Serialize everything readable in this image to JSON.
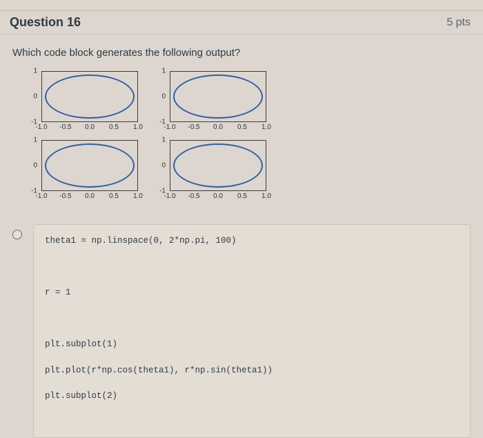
{
  "header": {
    "title": "Question 16",
    "points": "5 pts"
  },
  "prompt": "Which code block generates the following output?",
  "chart_data": [
    {
      "type": "line",
      "parametric": true,
      "x_expr": "cos(t)",
      "y_expr": "sin(t)",
      "xlim": [
        -1.0,
        1.0
      ],
      "ylim": [
        -1,
        1
      ],
      "xticks": [
        "-1.0",
        "-0.5",
        "0.0",
        "0.5",
        "1.0"
      ],
      "yticks": [
        "1",
        "0",
        "-1"
      ]
    },
    {
      "type": "line",
      "parametric": true,
      "x_expr": "cos(t)",
      "y_expr": "sin(t)",
      "xlim": [
        -1.0,
        1.0
      ],
      "ylim": [
        -1,
        1
      ],
      "xticks": [
        "-1.0",
        "-0.5",
        "0.0",
        "0.5",
        "1.0"
      ],
      "yticks": [
        "1",
        "0",
        "-1"
      ]
    },
    {
      "type": "line",
      "parametric": true,
      "x_expr": "cos(t)",
      "y_expr": "sin(t)",
      "xlim": [
        -1.0,
        1.0
      ],
      "ylim": [
        -1,
        1
      ],
      "xticks": [
        "-1.0",
        "-0.5",
        "0.0",
        "0.5",
        "1.0"
      ],
      "yticks": [
        "1",
        "0",
        "-1"
      ]
    },
    {
      "type": "line",
      "parametric": true,
      "x_expr": "cos(t)",
      "y_expr": "sin(t)",
      "xlim": [
        -1.0,
        1.0
      ],
      "ylim": [
        -1,
        1
      ],
      "xticks": [
        "-1.0",
        "-0.5",
        "0.0",
        "0.5",
        "1.0"
      ],
      "yticks": [
        "1",
        "0",
        "-1"
      ]
    }
  ],
  "option": {
    "code_line1": "theta1 = np.linspace(0, 2*np.pi, 100)",
    "code_line2": "r = 1",
    "code_line3": "plt.subplot(1)",
    "code_line4": "plt.plot(r*np.cos(theta1), r*np.sin(theta1))",
    "code_line5": "plt.subplot(2)"
  }
}
